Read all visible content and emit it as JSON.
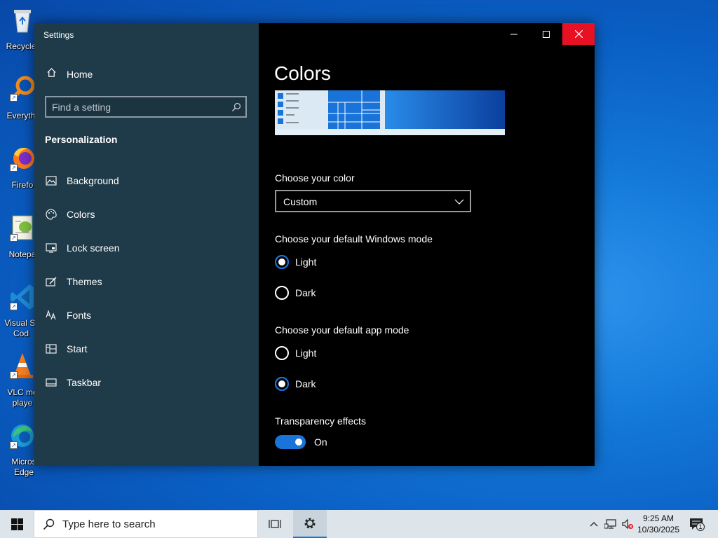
{
  "desktop": {
    "icons": [
      {
        "label": "Recycle",
        "name": "recycle-bin"
      },
      {
        "label": "Everyth",
        "name": "everything"
      },
      {
        "label": "Firefo",
        "name": "firefox"
      },
      {
        "label": "Notepa",
        "name": "notepad"
      },
      {
        "label": "Visual St\nCod",
        "name": "vscode"
      },
      {
        "label": "VLC me\nplaye",
        "name": "vlc"
      },
      {
        "label": "Micros\nEdge",
        "name": "edge"
      }
    ]
  },
  "window": {
    "title": "Settings",
    "caption_buttons": [
      "minimize-icon",
      "maximize-icon",
      "close-icon"
    ]
  },
  "sidebar": {
    "home_label": "Home",
    "search_placeholder": "Find a setting",
    "section_title": "Personalization",
    "items": [
      {
        "label": "Background",
        "icon": "picture-icon"
      },
      {
        "label": "Colors",
        "icon": "palette-icon"
      },
      {
        "label": "Lock screen",
        "icon": "monitor-icon"
      },
      {
        "label": "Themes",
        "icon": "brush-icon"
      },
      {
        "label": "Fonts",
        "icon": "fonts-icon"
      },
      {
        "label": "Start",
        "icon": "start-grid-icon"
      },
      {
        "label": "Taskbar",
        "icon": "taskbar-icon"
      }
    ]
  },
  "main": {
    "title": "Colors",
    "choose_color_label": "Choose your color",
    "choose_color_value": "Custom",
    "windows_mode_label": "Choose your default Windows mode",
    "windows_mode_options": [
      "Light",
      "Dark"
    ],
    "windows_mode_selected": "Light",
    "app_mode_label": "Choose your default app mode",
    "app_mode_options": [
      "Light",
      "Dark"
    ],
    "app_mode_selected": "Dark",
    "transparency_label": "Transparency effects",
    "transparency_value": "On"
  },
  "taskbar": {
    "search_placeholder": "Type here to search",
    "time": "9:25 AM",
    "date": "10/30/2025",
    "notification_count": "1"
  },
  "colors": {
    "accent": "#1a73d9",
    "close_button": "#e81123",
    "sidebar_bg": "#1f3a48"
  }
}
